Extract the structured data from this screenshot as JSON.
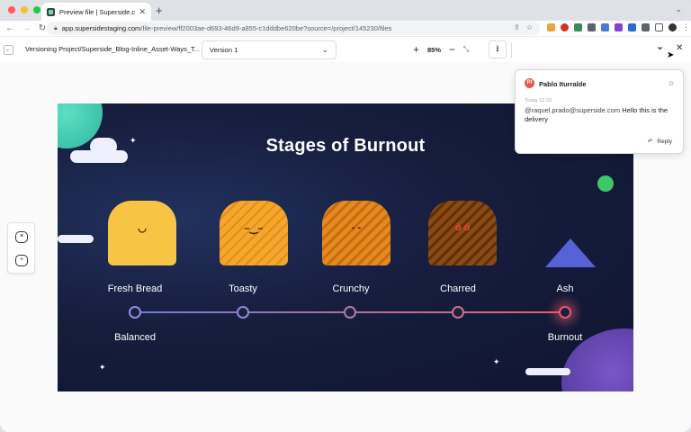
{
  "browser": {
    "tab_title": "Preview file | Superside.com",
    "tab_close": "✕",
    "new_tab": "+",
    "url_host": "app.supersidestaging.com",
    "url_path": "/file-preview/ff2003ae-d693-46d9-a855-c1dddbe620be?source=/project/145230/files",
    "traffic_colors": [
      "#ff5f57",
      "#febc2e",
      "#28c840"
    ]
  },
  "header": {
    "back_glyph": "←",
    "project_path": "Versioning Project/Superside_Blog-Inline_Asset-Ways_T...",
    "version_value": "Version 1",
    "zoom_in": "+",
    "zoom_level": "85%",
    "zoom_out": "−",
    "fit_glyph": "⤡",
    "download_glyph": "⭳",
    "filter_glyph": "⏷",
    "close_glyph": "✕"
  },
  "artwork": {
    "title": "Stages of Burnout",
    "stages": [
      {
        "label": "Fresh Bread",
        "color": "#f8c443",
        "face": "◡"
      },
      {
        "label": "Toasty",
        "color": "#f4a72a",
        "face": "–‿–"
      },
      {
        "label": "Crunchy",
        "color": "#e8891f",
        "face": "- -"
      },
      {
        "label": "Charred",
        "color": "#8a4a12",
        "face": "ò ó"
      },
      {
        "label": "Ash",
        "color": "",
        "face": ""
      }
    ],
    "start_label": "Balanced",
    "end_label": "Burnout"
  },
  "comment": {
    "avatar_initials": "PI",
    "author": "Pablo Iturralde",
    "time": "Today 12:33",
    "mention": "@raquel.prado@superside.com",
    "text": " Hello this is the delivery",
    "reply_label": "Reply",
    "reply_glyph": "↶",
    "resolve_glyph": "⊙"
  }
}
